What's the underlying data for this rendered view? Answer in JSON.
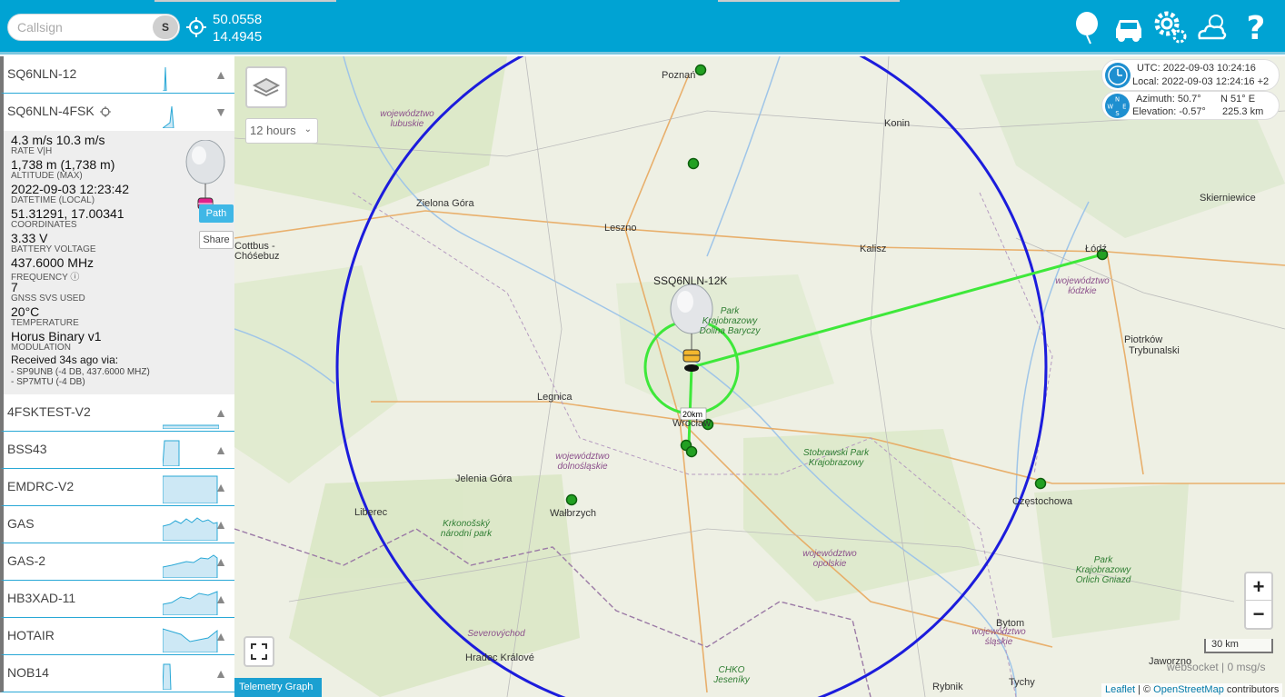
{
  "topbar": {
    "callsign_placeholder": "Callsign",
    "search_label": "S",
    "lat": "50.0558",
    "lon": "14.4945",
    "accent": "#00a3d3"
  },
  "sidebar": {
    "items_before": [
      {
        "label": "SQ6NLN-12",
        "chevron": "▲"
      }
    ],
    "expanded": {
      "label": "SQ6NLN-4FSK",
      "chevron": "▼",
      "fields": [
        {
          "value": "4.3 m/s 10.3 m/s",
          "key": "RATE V|H"
        },
        {
          "value": "1,738 m (1,738 m)",
          "key": "ALTITUDE (MAX)"
        },
        {
          "value": "2022-09-03 12:23:42",
          "key": "DATETIME (LOCAL)"
        },
        {
          "value": "51.31291, 17.00341",
          "key": "COORDINATES"
        },
        {
          "value": "3.33 V",
          "key": "BATTERY VOLTAGE"
        },
        {
          "value": "437.6000 MHz",
          "key": "FREQUENCY ⓘ"
        },
        {
          "value": "7",
          "key": "GNSS SVS USED"
        },
        {
          "value": "20°C",
          "key": "TEMPERATURE"
        },
        {
          "value": "Horus Binary v1",
          "key": "MODULATION"
        }
      ],
      "received": "Received 34s ago via:",
      "receivers": [
        "- SP9UNB (-4 DB, 437.6000 MHZ)",
        "- SP7MTU (-4 DB)"
      ],
      "path_label": "Path",
      "share_label": "Share"
    },
    "items_after": [
      {
        "label": "4FSKTEST-V2",
        "chevron": "▲"
      },
      {
        "label": "BSS43",
        "chevron": "▲"
      },
      {
        "label": "EMDRC-V2",
        "chevron": "▲"
      },
      {
        "label": "GAS",
        "chevron": "▲"
      },
      {
        "label": "GAS-2",
        "chevron": "▲"
      },
      {
        "label": "HB3XAD-11",
        "chevron": "▲"
      },
      {
        "label": "HOTAIR",
        "chevron": "▲"
      },
      {
        "label": "NOB14",
        "chevron": "▲"
      }
    ]
  },
  "map": {
    "time_range": "12 hours",
    "utc": "UTC: 2022-09-03 10:24:16",
    "local": "Local: 2022-09-03 12:24:16 +2",
    "azimuth": "Azimuth: 50.7°",
    "bearing": "N 51° E",
    "elevation": "Elevation: -0.57°",
    "distance": "225.3 km",
    "payload_label": "SSQ6NLN-12K",
    "radius_label": "20km",
    "scale": "30 km",
    "websocket": "websocket | 0 msg/s",
    "attribution": {
      "leaflet": "Leaflet",
      "sep": " | © ",
      "osm": "OpenStreetMap",
      "rest": " contributors"
    },
    "telemetry": "Telemetry Graph",
    "zoom_in": "+",
    "zoom_out": "−",
    "cities": [
      {
        "name": "Poznań"
      },
      {
        "name": "Konin"
      },
      {
        "name": "Zielona Góra"
      },
      {
        "name": "Leszno"
      },
      {
        "name": "Kalisz"
      },
      {
        "name": "Skierniewice"
      },
      {
        "name": "Łódź"
      },
      {
        "name": "Cottbus -"
      },
      {
        "name": "Chóśebuz"
      },
      {
        "name": "Piotrków"
      },
      {
        "name": "Trybunalski"
      },
      {
        "name": "Legnica"
      },
      {
        "name": "Wrocław"
      },
      {
        "name": "Jelenia Góra"
      },
      {
        "name": "Liberec"
      },
      {
        "name": "Wałbrzych"
      },
      {
        "name": "Częstochowa"
      },
      {
        "name": "Bytom"
      },
      {
        "name": "Hradec Králové"
      },
      {
        "name": "Jaworzno"
      },
      {
        "name": "Tychy"
      },
      {
        "name": "Rybnik"
      }
    ],
    "regions": [
      {
        "text": "województwo lubuskie"
      },
      {
        "text": "województwo łódzkie"
      },
      {
        "text": "województwo dolnośląskie"
      },
      {
        "text": "województwo opolskie"
      },
      {
        "text": "województwo śląskie"
      },
      {
        "text": "Severovýchod"
      }
    ],
    "parks": [
      {
        "text": "Park Krajobrazowy Dolina Baryczy"
      },
      {
        "text": "Stobrawski Park Krajobrazowy"
      },
      {
        "text": "Krkonošský národní park"
      },
      {
        "text": "Park Krajobrazowy Orlich Gniazd"
      },
      {
        "text": "CHKO Jeseníky"
      }
    ]
  }
}
